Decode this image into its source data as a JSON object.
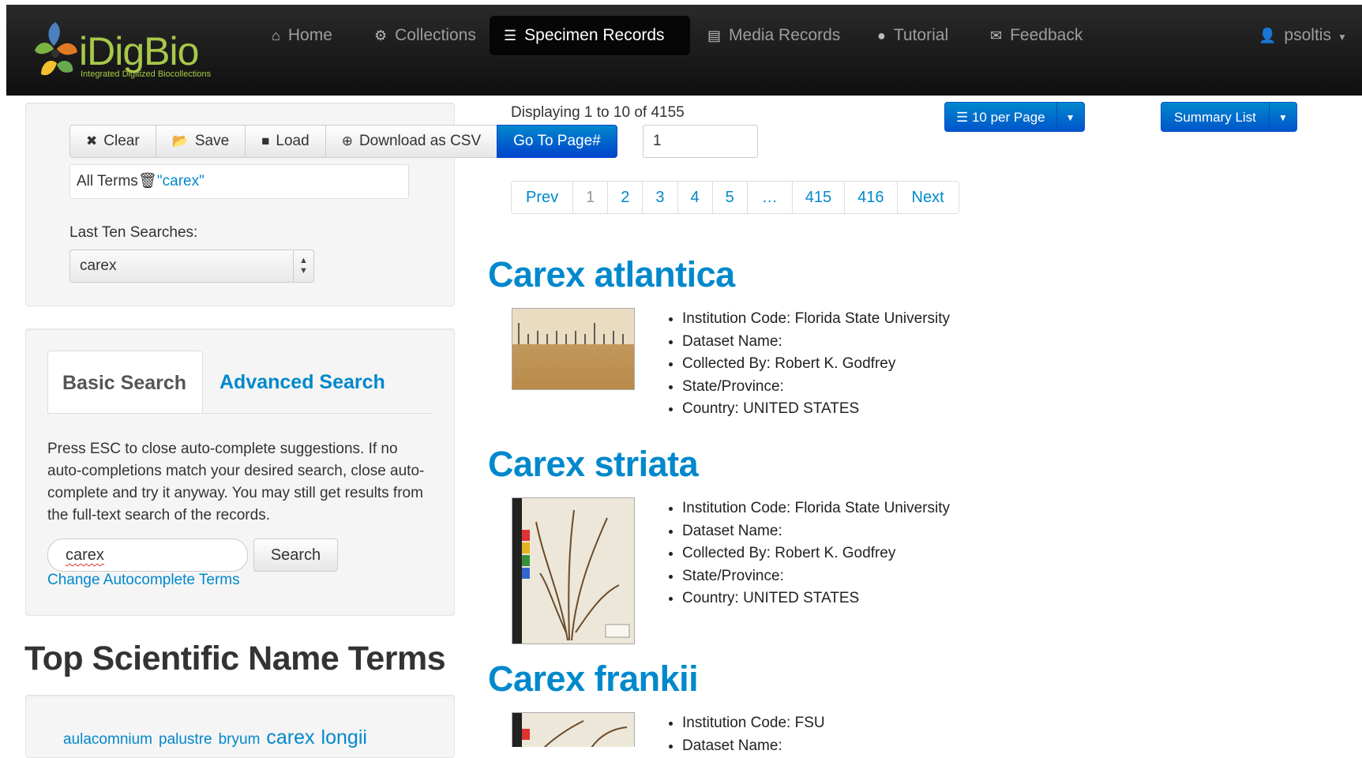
{
  "navbar": {
    "logo_text": "iDigBio",
    "logo_subtitle": "Integrated Digitized Biocollections",
    "items": [
      {
        "label": "Home",
        "icon": "home-icon"
      },
      {
        "label": "Collections",
        "icon": "gear-icon"
      },
      {
        "label": "Specimen Records",
        "icon": "list-icon",
        "active": true
      },
      {
        "label": "Media Records",
        "icon": "film-icon"
      },
      {
        "label": "Tutorial",
        "icon": "question-circle-icon"
      },
      {
        "label": "Feedback",
        "icon": "envelope-icon"
      }
    ],
    "user": "psoltis"
  },
  "toolbar": {
    "clear_label": "Clear",
    "save_label": "Save",
    "load_label": "Load",
    "download_label": "Download as CSV",
    "goto_label": "Go To Page#",
    "page_value": "1"
  },
  "terms": {
    "prefix": "All Terms",
    "query": "\"carex\""
  },
  "last_searches": {
    "label": "Last Ten Searches:",
    "selected": "carex"
  },
  "search_tabs": {
    "basic": "Basic Search",
    "advanced": "Advanced Search"
  },
  "basic_search": {
    "help": "Press ESC to close auto-complete suggestions. If no auto-completions match your desired search, close auto-complete and try it anyway. You may still get results from the full-text search of the records.",
    "input_value": "carex",
    "button": "Search",
    "change_link": "Change Autocomplete Terms"
  },
  "top_terms": {
    "heading": "Top Scientific Name Terms",
    "cloud": [
      "aulacomnium",
      "palustre",
      "bryum",
      "carex",
      "longii"
    ]
  },
  "results": {
    "displaying": "Displaying 1 to 10 of 4155",
    "per_page": "10 per Page",
    "view_mode": "Summary List",
    "pagination": [
      "Prev",
      "1",
      "2",
      "3",
      "4",
      "5",
      "…",
      "415",
      "416",
      "Next"
    ],
    "current_page": "1",
    "records": [
      {
        "title": "Carex atlantica",
        "facts": [
          "Institution Code: Florida State University",
          "Dataset Name:",
          "Collected By: Robert K. Godfrey",
          "State/Province:",
          "Country: UNITED STATES"
        ]
      },
      {
        "title": "Carex striata",
        "facts": [
          "Institution Code: Florida State University",
          "Dataset Name:",
          "Collected By: Robert K. Godfrey",
          "State/Province:",
          "Country: UNITED STATES"
        ]
      },
      {
        "title": "Carex frankii",
        "facts": [
          "Institution Code: FSU",
          "Dataset Name:"
        ]
      }
    ]
  },
  "colors": {
    "link": "#0088cc",
    "primary": "#0044cc",
    "navbar": "#1b1b1b",
    "logo_green": "#a8c84a"
  }
}
